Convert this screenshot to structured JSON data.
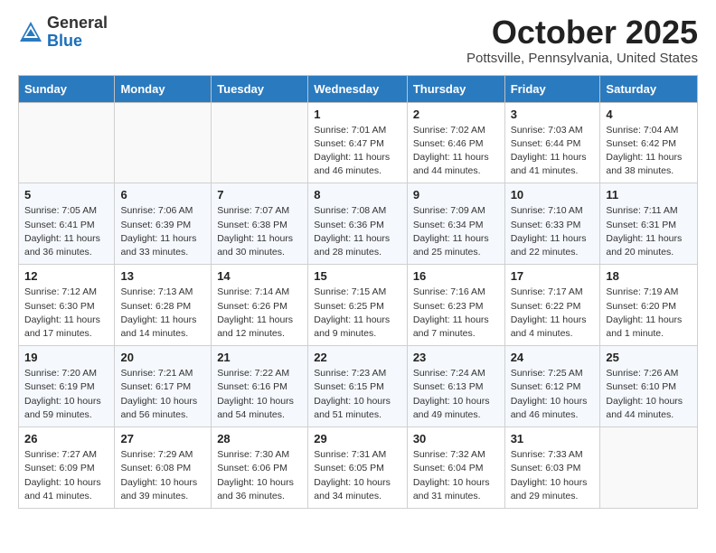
{
  "header": {
    "logo_general": "General",
    "logo_blue": "Blue",
    "month_title": "October 2025",
    "location": "Pottsville, Pennsylvania, United States"
  },
  "days_of_week": [
    "Sunday",
    "Monday",
    "Tuesday",
    "Wednesday",
    "Thursday",
    "Friday",
    "Saturday"
  ],
  "weeks": [
    [
      {
        "day": "",
        "sunrise": "",
        "sunset": "",
        "daylight": ""
      },
      {
        "day": "",
        "sunrise": "",
        "sunset": "",
        "daylight": ""
      },
      {
        "day": "",
        "sunrise": "",
        "sunset": "",
        "daylight": ""
      },
      {
        "day": "1",
        "sunrise": "Sunrise: 7:01 AM",
        "sunset": "Sunset: 6:47 PM",
        "daylight": "Daylight: 11 hours and 46 minutes."
      },
      {
        "day": "2",
        "sunrise": "Sunrise: 7:02 AM",
        "sunset": "Sunset: 6:46 PM",
        "daylight": "Daylight: 11 hours and 44 minutes."
      },
      {
        "day": "3",
        "sunrise": "Sunrise: 7:03 AM",
        "sunset": "Sunset: 6:44 PM",
        "daylight": "Daylight: 11 hours and 41 minutes."
      },
      {
        "day": "4",
        "sunrise": "Sunrise: 7:04 AM",
        "sunset": "Sunset: 6:42 PM",
        "daylight": "Daylight: 11 hours and 38 minutes."
      }
    ],
    [
      {
        "day": "5",
        "sunrise": "Sunrise: 7:05 AM",
        "sunset": "Sunset: 6:41 PM",
        "daylight": "Daylight: 11 hours and 36 minutes."
      },
      {
        "day": "6",
        "sunrise": "Sunrise: 7:06 AM",
        "sunset": "Sunset: 6:39 PM",
        "daylight": "Daylight: 11 hours and 33 minutes."
      },
      {
        "day": "7",
        "sunrise": "Sunrise: 7:07 AM",
        "sunset": "Sunset: 6:38 PM",
        "daylight": "Daylight: 11 hours and 30 minutes."
      },
      {
        "day": "8",
        "sunrise": "Sunrise: 7:08 AM",
        "sunset": "Sunset: 6:36 PM",
        "daylight": "Daylight: 11 hours and 28 minutes."
      },
      {
        "day": "9",
        "sunrise": "Sunrise: 7:09 AM",
        "sunset": "Sunset: 6:34 PM",
        "daylight": "Daylight: 11 hours and 25 minutes."
      },
      {
        "day": "10",
        "sunrise": "Sunrise: 7:10 AM",
        "sunset": "Sunset: 6:33 PM",
        "daylight": "Daylight: 11 hours and 22 minutes."
      },
      {
        "day": "11",
        "sunrise": "Sunrise: 7:11 AM",
        "sunset": "Sunset: 6:31 PM",
        "daylight": "Daylight: 11 hours and 20 minutes."
      }
    ],
    [
      {
        "day": "12",
        "sunrise": "Sunrise: 7:12 AM",
        "sunset": "Sunset: 6:30 PM",
        "daylight": "Daylight: 11 hours and 17 minutes."
      },
      {
        "day": "13",
        "sunrise": "Sunrise: 7:13 AM",
        "sunset": "Sunset: 6:28 PM",
        "daylight": "Daylight: 11 hours and 14 minutes."
      },
      {
        "day": "14",
        "sunrise": "Sunrise: 7:14 AM",
        "sunset": "Sunset: 6:26 PM",
        "daylight": "Daylight: 11 hours and 12 minutes."
      },
      {
        "day": "15",
        "sunrise": "Sunrise: 7:15 AM",
        "sunset": "Sunset: 6:25 PM",
        "daylight": "Daylight: 11 hours and 9 minutes."
      },
      {
        "day": "16",
        "sunrise": "Sunrise: 7:16 AM",
        "sunset": "Sunset: 6:23 PM",
        "daylight": "Daylight: 11 hours and 7 minutes."
      },
      {
        "day": "17",
        "sunrise": "Sunrise: 7:17 AM",
        "sunset": "Sunset: 6:22 PM",
        "daylight": "Daylight: 11 hours and 4 minutes."
      },
      {
        "day": "18",
        "sunrise": "Sunrise: 7:19 AM",
        "sunset": "Sunset: 6:20 PM",
        "daylight": "Daylight: 11 hours and 1 minute."
      }
    ],
    [
      {
        "day": "19",
        "sunrise": "Sunrise: 7:20 AM",
        "sunset": "Sunset: 6:19 PM",
        "daylight": "Daylight: 10 hours and 59 minutes."
      },
      {
        "day": "20",
        "sunrise": "Sunrise: 7:21 AM",
        "sunset": "Sunset: 6:17 PM",
        "daylight": "Daylight: 10 hours and 56 minutes."
      },
      {
        "day": "21",
        "sunrise": "Sunrise: 7:22 AM",
        "sunset": "Sunset: 6:16 PM",
        "daylight": "Daylight: 10 hours and 54 minutes."
      },
      {
        "day": "22",
        "sunrise": "Sunrise: 7:23 AM",
        "sunset": "Sunset: 6:15 PM",
        "daylight": "Daylight: 10 hours and 51 minutes."
      },
      {
        "day": "23",
        "sunrise": "Sunrise: 7:24 AM",
        "sunset": "Sunset: 6:13 PM",
        "daylight": "Daylight: 10 hours and 49 minutes."
      },
      {
        "day": "24",
        "sunrise": "Sunrise: 7:25 AM",
        "sunset": "Sunset: 6:12 PM",
        "daylight": "Daylight: 10 hours and 46 minutes."
      },
      {
        "day": "25",
        "sunrise": "Sunrise: 7:26 AM",
        "sunset": "Sunset: 6:10 PM",
        "daylight": "Daylight: 10 hours and 44 minutes."
      }
    ],
    [
      {
        "day": "26",
        "sunrise": "Sunrise: 7:27 AM",
        "sunset": "Sunset: 6:09 PM",
        "daylight": "Daylight: 10 hours and 41 minutes."
      },
      {
        "day": "27",
        "sunrise": "Sunrise: 7:29 AM",
        "sunset": "Sunset: 6:08 PM",
        "daylight": "Daylight: 10 hours and 39 minutes."
      },
      {
        "day": "28",
        "sunrise": "Sunrise: 7:30 AM",
        "sunset": "Sunset: 6:06 PM",
        "daylight": "Daylight: 10 hours and 36 minutes."
      },
      {
        "day": "29",
        "sunrise": "Sunrise: 7:31 AM",
        "sunset": "Sunset: 6:05 PM",
        "daylight": "Daylight: 10 hours and 34 minutes."
      },
      {
        "day": "30",
        "sunrise": "Sunrise: 7:32 AM",
        "sunset": "Sunset: 6:04 PM",
        "daylight": "Daylight: 10 hours and 31 minutes."
      },
      {
        "day": "31",
        "sunrise": "Sunrise: 7:33 AM",
        "sunset": "Sunset: 6:03 PM",
        "daylight": "Daylight: 10 hours and 29 minutes."
      },
      {
        "day": "",
        "sunrise": "",
        "sunset": "",
        "daylight": ""
      }
    ]
  ]
}
